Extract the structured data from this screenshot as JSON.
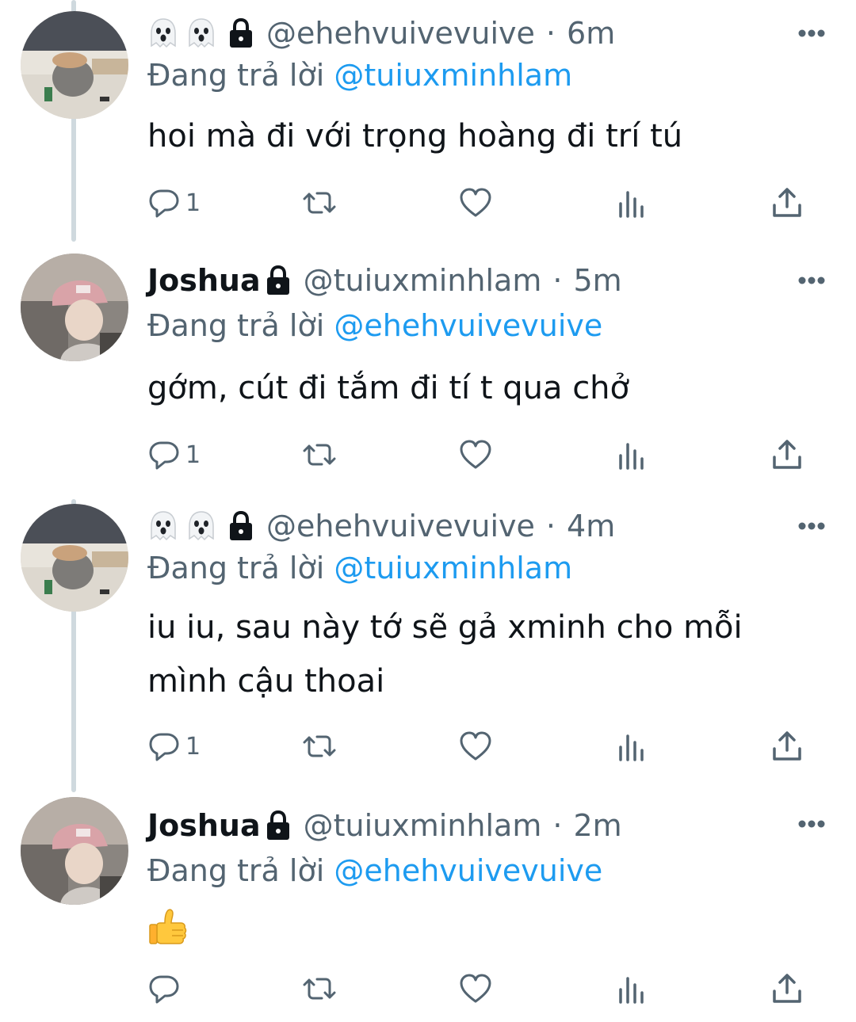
{
  "colors": {
    "primary_text": "#0f1419",
    "secondary_text": "#536471",
    "link": "#1d9bf0",
    "thread_line": "#cfd9de"
  },
  "tweets": [
    {
      "display_name": "",
      "name_icons": [
        "ghost-icon",
        "ghost-icon",
        "lock-icon"
      ],
      "handle": "@ehehvuivevuive",
      "time": "6m",
      "reply_prefix": "Đang trả lời",
      "reply_to": "@tuiuxminhlam",
      "text": "hoi mà đi với trọng hoàng đi trí tú",
      "reply_count": "1"
    },
    {
      "display_name": "Joshua",
      "name_icons": [
        "lock-icon"
      ],
      "handle": "@tuiuxminhlam",
      "time": "5m",
      "reply_prefix": "Đang trả lời",
      "reply_to": "@ehehvuivevuive",
      "text": "gớm, cút đi tắm đi tí t qua chở",
      "reply_count": "1"
    },
    {
      "display_name": "",
      "name_icons": [
        "ghost-icon",
        "ghost-icon",
        "lock-icon"
      ],
      "handle": "@ehehvuivevuive",
      "time": "4m",
      "reply_prefix": "Đang trả lời",
      "reply_to": "@tuiuxminhlam",
      "text": "iu iu, sau này tớ sẽ gả xminh cho mỗi mình cậu thoai",
      "reply_count": "1"
    },
    {
      "display_name": "Joshua",
      "name_icons": [
        "lock-icon"
      ],
      "handle": "@tuiuxminhlam",
      "time": "2m",
      "reply_prefix": "Đang trả lời",
      "reply_to": "@ehehvuivevuive",
      "text": "",
      "body_emoji": "thumbs-up-emoji",
      "reply_count": ""
    }
  ],
  "separator": "·"
}
